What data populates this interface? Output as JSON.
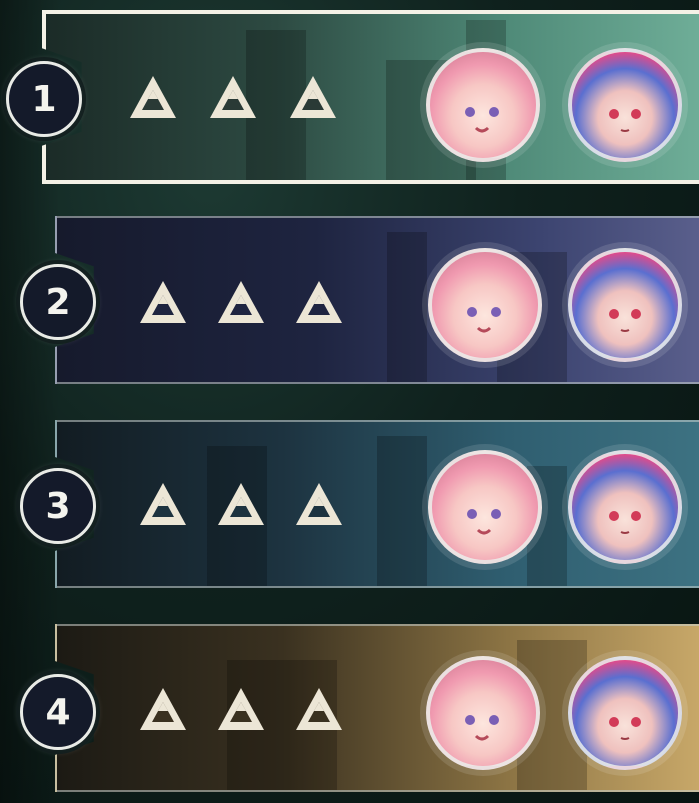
{
  "stages": [
    {
      "number": "1",
      "selected": true,
      "theme": "green",
      "stars": [
        "triad-icon",
        "triad-icon",
        "triad-icon"
      ],
      "avatars": [
        "pink-hair-character-avatar",
        "blue-hair-character-avatar"
      ]
    },
    {
      "number": "2",
      "selected": false,
      "theme": "navy",
      "stars": [
        "triad-icon",
        "triad-icon",
        "triad-icon"
      ],
      "avatars": [
        "pink-hair-character-avatar",
        "blue-hair-character-avatar"
      ]
    },
    {
      "number": "3",
      "selected": false,
      "theme": "teal",
      "stars": [
        "triad-icon",
        "triad-icon",
        "triad-icon"
      ],
      "avatars": [
        "pink-hair-character-avatar",
        "blue-hair-character-avatar"
      ]
    },
    {
      "number": "4",
      "selected": false,
      "theme": "amber",
      "stars": [
        "triad-icon",
        "triad-icon",
        "triad-icon"
      ],
      "avatars": [
        "pink-hair-character-avatar",
        "blue-hair-character-avatar"
      ]
    }
  ],
  "colors": {
    "badge_bg": "#141a2a",
    "badge_text": "#f4f4ee",
    "star_fill": "#ece6d6",
    "selected_border": "#f4f1e6"
  }
}
